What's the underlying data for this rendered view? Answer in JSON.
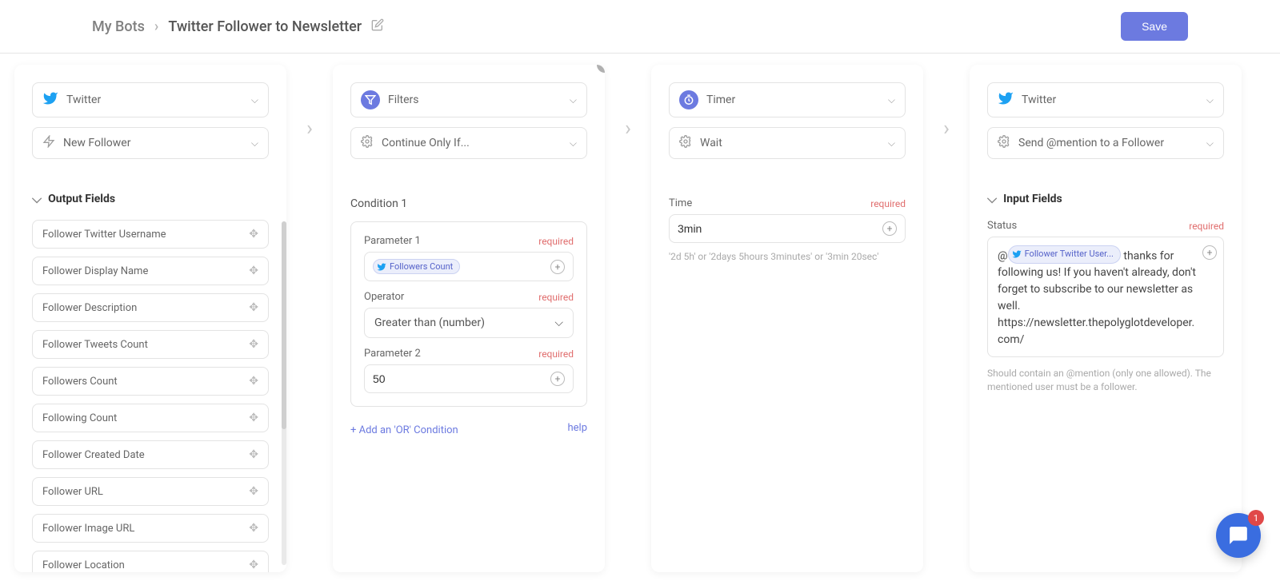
{
  "header": {
    "breadcrumb_root": "My Bots",
    "breadcrumb_current": "Twitter Follower to Newsletter",
    "save_label": "Save"
  },
  "steps": [
    {
      "app": "Twitter",
      "action": "New Follower",
      "section_title": "Output Fields",
      "output_fields": [
        "Follower Twitter Username",
        "Follower Display Name",
        "Follower Description",
        "Follower Tweets Count",
        "Followers Count",
        "Following Count",
        "Follower Created Date",
        "Follower URL",
        "Follower Image URL",
        "Follower Location"
      ]
    },
    {
      "app": "Filters",
      "action": "Continue Only If...",
      "condition_title": "Condition 1",
      "param1_label": "Parameter 1",
      "param1_token": "Followers Count",
      "operator_label": "Operator",
      "operator_value": "Greater than (number)",
      "param2_label": "Parameter 2",
      "param2_value": "50",
      "add_or_label": "+ Add an 'OR' Condition",
      "help_label": "help",
      "required": "required"
    },
    {
      "app": "Timer",
      "action": "Wait",
      "time_label": "Time",
      "time_value": "3min",
      "hint": "'2d 5h' or '2days 5hours 3minutes' or '3min 20sec'",
      "required": "required"
    },
    {
      "app": "Twitter",
      "action": "Send @mention to a Follower",
      "section_title": "Input Fields",
      "status_label": "Status",
      "status_prefix": "@",
      "status_token": "Follower Twitter User...",
      "status_text": " thanks for following us! If you haven't already, don't forget to subscribe to our newsletter as well. https://newsletter.thepolyglotdeveloper.com/",
      "status_hint": "Should contain an @mention (only one allowed). The mentioned user must be a follower.",
      "required": "required"
    }
  ],
  "chat_badge": "1"
}
